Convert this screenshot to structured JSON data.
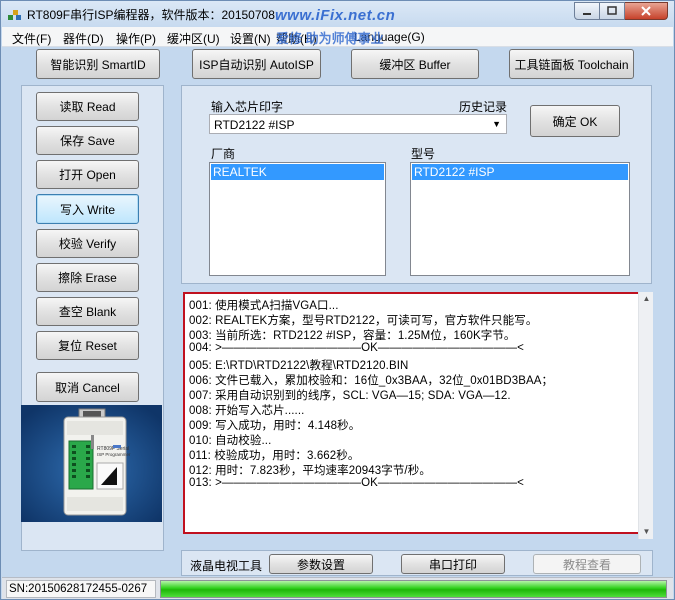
{
  "window": {
    "title": "RT809F串行ISP编程器，软件版本：20150708",
    "watermark": "www.iFix.net.cn",
    "watermark_sub": "爱修 助为师傅事业"
  },
  "menu": {
    "items": [
      "文件(F)",
      "器件(D)",
      "操作(P)",
      "缓冲区(U)",
      "设置(N)",
      "帮助(H)",
      "Language(G)"
    ]
  },
  "top_buttons": {
    "smartid": "智能识别 SmartID",
    "autoisp": "ISP自动识别 AutoISP",
    "buffer": "缓冲区 Buffer",
    "toolchain": "工具链面板 Toolchain"
  },
  "left_buttons": {
    "read": "读取 Read",
    "save": "保存 Save",
    "open": "打开 Open",
    "write": "写入 Write",
    "verify": "校验 Verify",
    "erase": "擦除 Erase",
    "blank": "查空 Blank",
    "reset": "复位 Reset",
    "cancel": "取消 Cancel"
  },
  "chip_panel": {
    "input_label": "输入芯片印字",
    "history_label": "历史记录",
    "chip_value": "RTD2122 #ISP",
    "ok_button": "确定 OK",
    "vendor_label": "厂商",
    "vendor_selected": "REALTEK",
    "model_label": "型号",
    "model_selected": "RTD2122 #ISP"
  },
  "log": {
    "lines": [
      "001: 使用模式A扫描VGA口...",
      "002: REALTEK方案，型号RTD2122，可读可写，官方软件只能写。",
      "003: 当前所选：RTD2122 #ISP，容量：1.25M位，160K字节。",
      "004: >————————————OK————————————<",
      "005: E:\\RTD\\RTD2122\\教程\\RTD2120.BIN",
      "006: 文件已载入，累加校验和：16位_0x3BAA，32位_0x01BD3BAA；",
      "007: 采用自动识别到的线序，SCL: VGA—15; SDA: VGA—12.",
      "008: 开始写入芯片......",
      "009: 写入成功，用时：4.148秒。",
      "010: 自动校验...",
      "011: 校验成功，用时：3.662秒。",
      "012: 用时：7.823秒，平均速率20943字节/秒。",
      "013: >————————————OK————————————<"
    ]
  },
  "bottom": {
    "lcd_tools_label": "液晶电视工具",
    "params_button": "参数设置",
    "serial_print_button": "串口打印",
    "tutorial_button": "教程查看"
  },
  "device_photo": {
    "label_line1": "RT809F Serial",
    "label_line2": "ISP Programmer"
  },
  "status": {
    "sn": "SN:20150628172455-0267",
    "progress": 1.0
  },
  "colors": {
    "selection": "#3399ff",
    "log_border": "#c0111f",
    "progress_green": "#2fd11b",
    "watermark": "#3a6fd1"
  }
}
